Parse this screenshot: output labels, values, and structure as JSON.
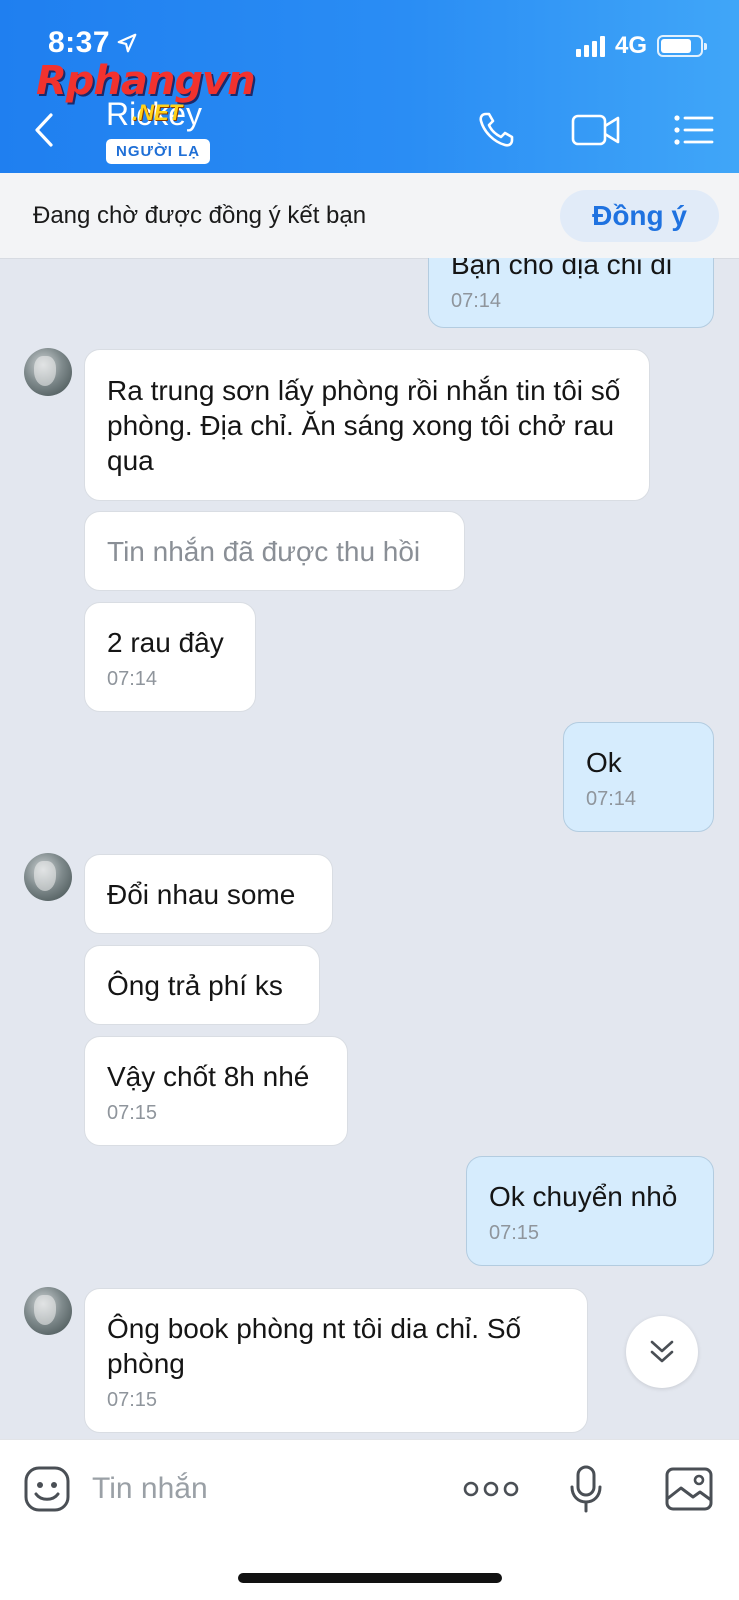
{
  "status_bar": {
    "time": "8:37",
    "network": "4G"
  },
  "watermark": {
    "brand": "Rphangvn",
    "suffix": ".NET"
  },
  "header": {
    "contact_name": "Rickey",
    "badge": "NGƯỜI LẠ",
    "icons": [
      "back-icon",
      "phone-icon",
      "video-call-icon",
      "menu-list-icon"
    ]
  },
  "request_bar": {
    "text": "Đang chờ được đồng ý kết bạn",
    "accept_label": "Đồng ý"
  },
  "messages": [
    {
      "direction": "out",
      "text": "Bạn cho địa chỉ đi",
      "time": "07:14"
    },
    {
      "direction": "in",
      "text": "Ra trung sơn lấy phòng rồi nhắn tin tôi số phòng. Địa chỉ. Ăn sáng xong tôi chở rau qua"
    },
    {
      "direction": "in",
      "text": "Tin nhắn đã được thu hồi",
      "recalled": true
    },
    {
      "direction": "in",
      "text": "2 rau đây",
      "time": "07:14"
    },
    {
      "direction": "out",
      "text": "Ok",
      "time": "07:14"
    },
    {
      "direction": "in",
      "text": "Đổi nhau some"
    },
    {
      "direction": "in",
      "text": "Ông trả phí ks"
    },
    {
      "direction": "in",
      "text": "Vậy chốt 8h nhé",
      "time": "07:15"
    },
    {
      "direction": "out",
      "text": "Ok chuyển nhỏ",
      "time": "07:15"
    },
    {
      "direction": "in",
      "text": "Ông book phòng nt tôi dia chỉ. Số phòng",
      "time": "07:15"
    }
  ],
  "composer": {
    "placeholder": "Tin nhắn",
    "icons": [
      "sticker-icon",
      "more-options-icon",
      "microphone-icon",
      "image-icon"
    ]
  },
  "colors": {
    "header_blue": "#1f7ff0",
    "chat_background": "#e3e7ef",
    "outgoing_bubble": "#d6ecfd",
    "incoming_bubble": "#ffffff",
    "accent": "#1f72e0"
  }
}
